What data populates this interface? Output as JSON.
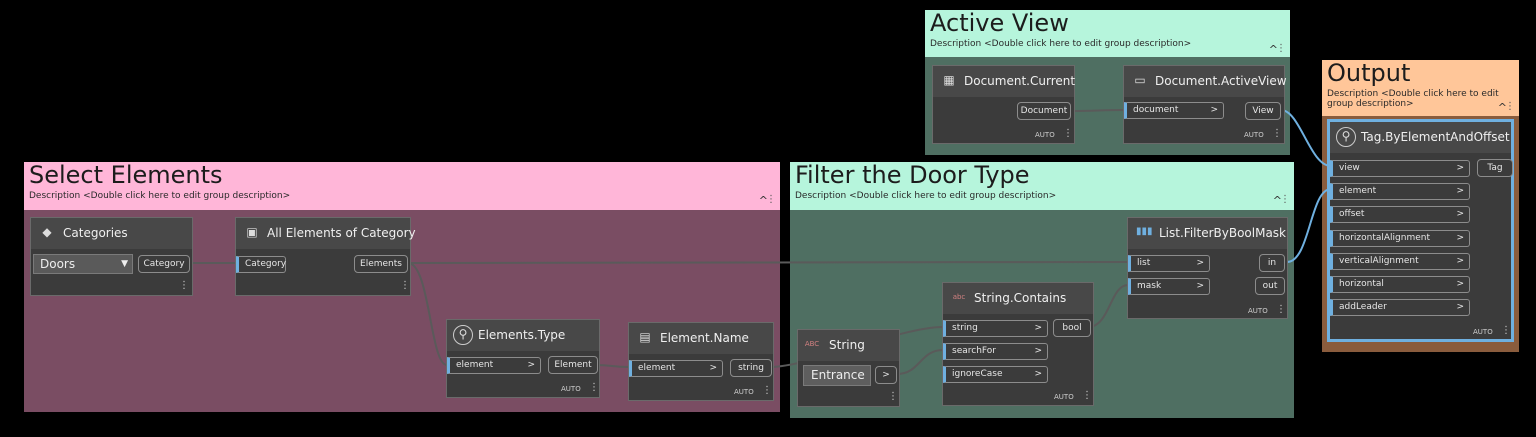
{
  "groups": {
    "select": {
      "title": "Select Elements",
      "description": "Description <Double click here to edit group description>",
      "color": "#ffb6d8",
      "body_color": "#7a4d63"
    },
    "filter": {
      "title": "Filter the Door Type",
      "description": "Description <Double click here to edit group description>",
      "color": "#b6f5dc",
      "body_color": "#4f6f62"
    },
    "active": {
      "title": "Active View",
      "description": "Description <Double click here to edit group description>",
      "color": "#b6f5dc",
      "body_color": "#4f6f62"
    },
    "output": {
      "title": "Output",
      "description": "Description <Double click here to edit group description>",
      "color": "#ffc699",
      "body_color": "#8a5c3d"
    }
  },
  "collapse_glyph": "^",
  "dots_glyph": "⋮",
  "auto_label": "AUTO",
  "chevron": ">",
  "nodes": {
    "categories": {
      "title": "Categories",
      "dropdown_value": "Doors",
      "output": "Category"
    },
    "all_elements": {
      "title": "All Elements of Category",
      "input": "Category",
      "output": "Elements"
    },
    "elements_type": {
      "title": "Elements.Type",
      "input": "element",
      "output": "Element"
    },
    "element_name": {
      "title": "Element.Name",
      "input": "element",
      "output": "string"
    },
    "string": {
      "title": "String",
      "icon_text": "ABC",
      "value": "Entrance",
      "output": ">"
    },
    "string_contains": {
      "title": "String.Contains",
      "inputs": [
        "string",
        "searchFor",
        "ignoreCase"
      ],
      "output": "bool"
    },
    "filter_mask": {
      "title": "List.FilterByBoolMask",
      "inputs": [
        "list",
        "mask"
      ],
      "outputs": [
        "in",
        "out"
      ]
    },
    "doc_current": {
      "title": "Document.Current",
      "output": "Document"
    },
    "doc_active": {
      "title": "Document.ActiveView",
      "input": "document",
      "output": "View"
    },
    "tag": {
      "title": "Tag.ByElementAndOffset",
      "inputs": [
        "view",
        "element",
        "offset",
        "horizontalAlignment",
        "verticalAlignment",
        "horizontal",
        "addLeader"
      ],
      "output": "Tag"
    }
  },
  "colors": {
    "wire": "#5a5a5a",
    "selected_wire": "#6fb0e0",
    "input_accent": "#6fb0e0"
  }
}
